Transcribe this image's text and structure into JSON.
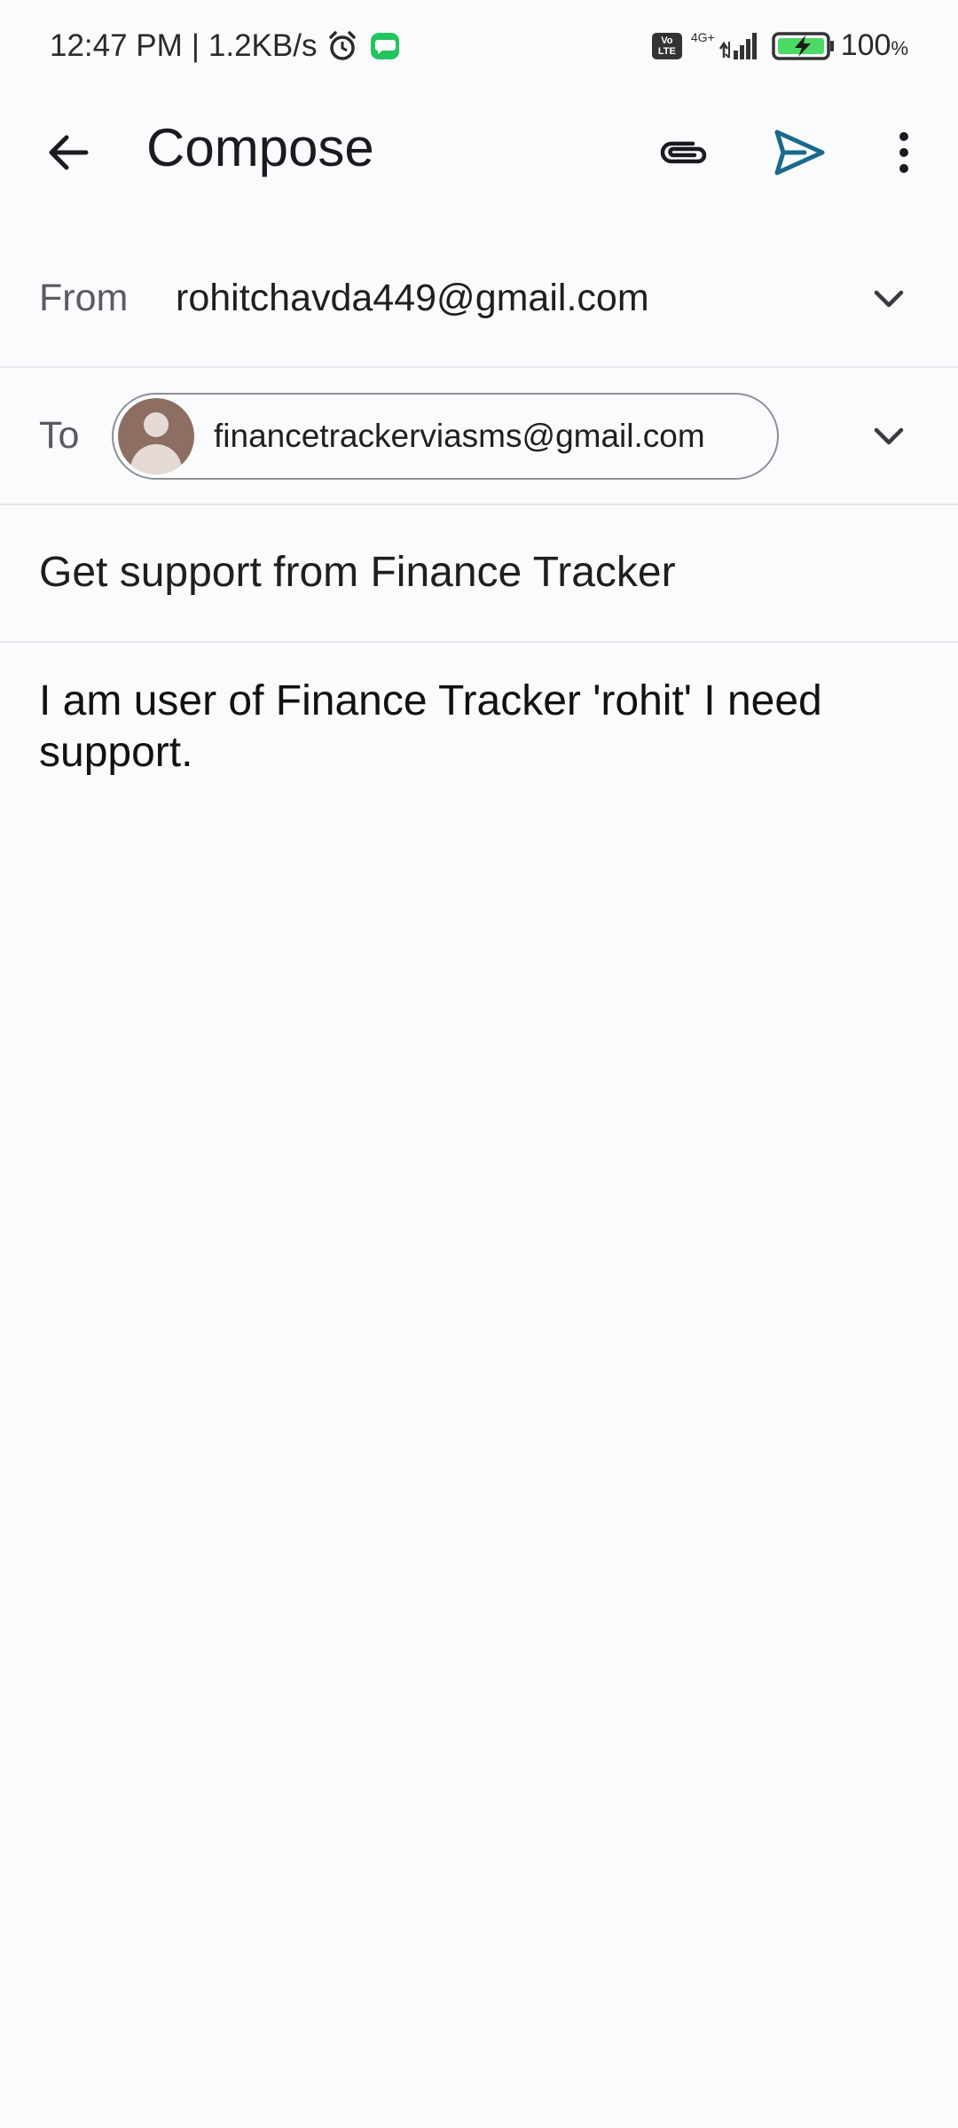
{
  "status_bar": {
    "time": "12:47 PM",
    "separator": "|",
    "speed": "1.2KB/s",
    "volte_top": "Vo",
    "volte_bottom": "LTE",
    "network": "4G+",
    "battery": "100",
    "battery_unit": "%",
    "icons": [
      "alarm-icon",
      "message-notification-icon",
      "volte-icon",
      "signal-icon",
      "battery-charging-icon"
    ]
  },
  "app_bar": {
    "title": "Compose",
    "icons": [
      "back-arrow-icon",
      "paperclip-icon",
      "send-icon",
      "more-vert-icon"
    ]
  },
  "compose": {
    "from_label": "From",
    "from_value": "rohitchavda449@gmail.com",
    "to_label": "To",
    "to_recipient": "financetrackerviasms@gmail.com",
    "subject": "Get support from Finance Tracker",
    "body": "I am user of Finance Tracker 'rohit' I need support."
  },
  "colors": {
    "background": "#fafbfd",
    "send_accent": "#1a6a8c",
    "avatar": "#8d6e63",
    "divider": "#e8e8ec"
  }
}
